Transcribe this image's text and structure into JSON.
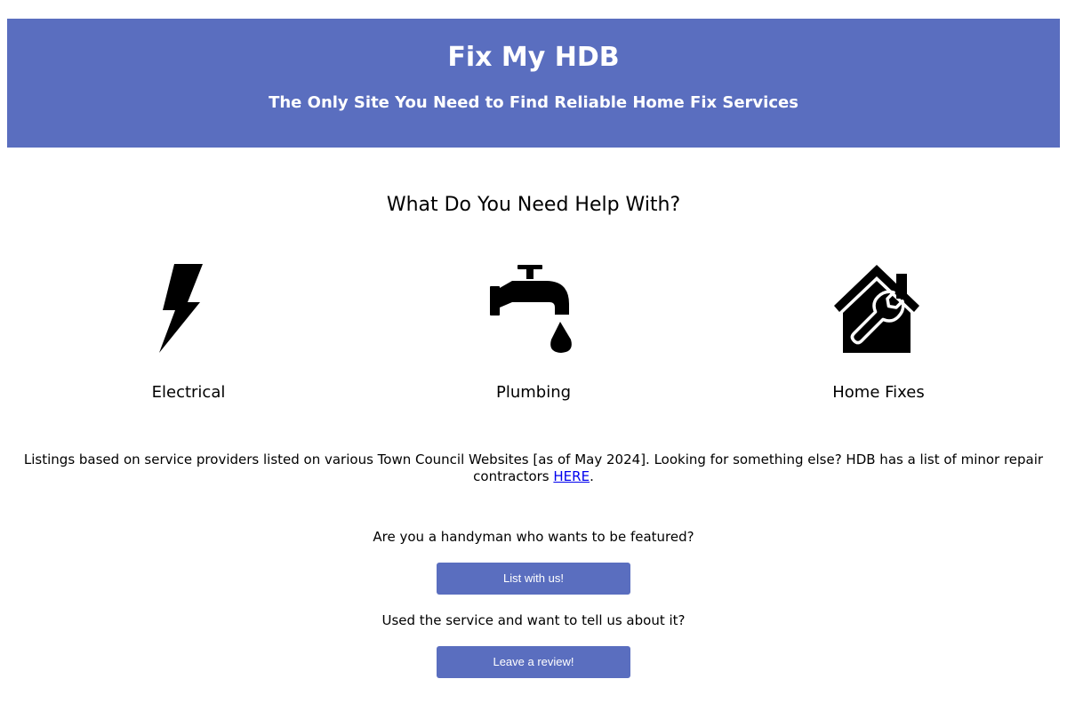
{
  "header": {
    "title": "Fix My HDB",
    "subtitle": "The Only Site You Need to Find Reliable Home Fix Services"
  },
  "services_section": {
    "heading": "What Do You Need Help With?",
    "items": [
      {
        "label": "Electrical",
        "icon": "lightning-bolt-icon"
      },
      {
        "label": "Plumbing",
        "icon": "faucet-icon"
      },
      {
        "label": "Home Fixes",
        "icon": "house-wrench-icon"
      }
    ]
  },
  "notice": {
    "text": "Listings based on service providers listed on various Town Council Websites [as of May 2024]. Looking for something else? HDB has a list of minor repair contractors ",
    "link_text": "HERE",
    "suffix": "."
  },
  "cta": {
    "handyman_question": "Are you a handyman who wants to be featured?",
    "list_button_label": "List with us!",
    "review_question": "Used the service and want to tell us about it?",
    "review_button_label": "Leave a review!"
  },
  "colors": {
    "brand": "#5a6ebf",
    "link": "#0000ee"
  }
}
